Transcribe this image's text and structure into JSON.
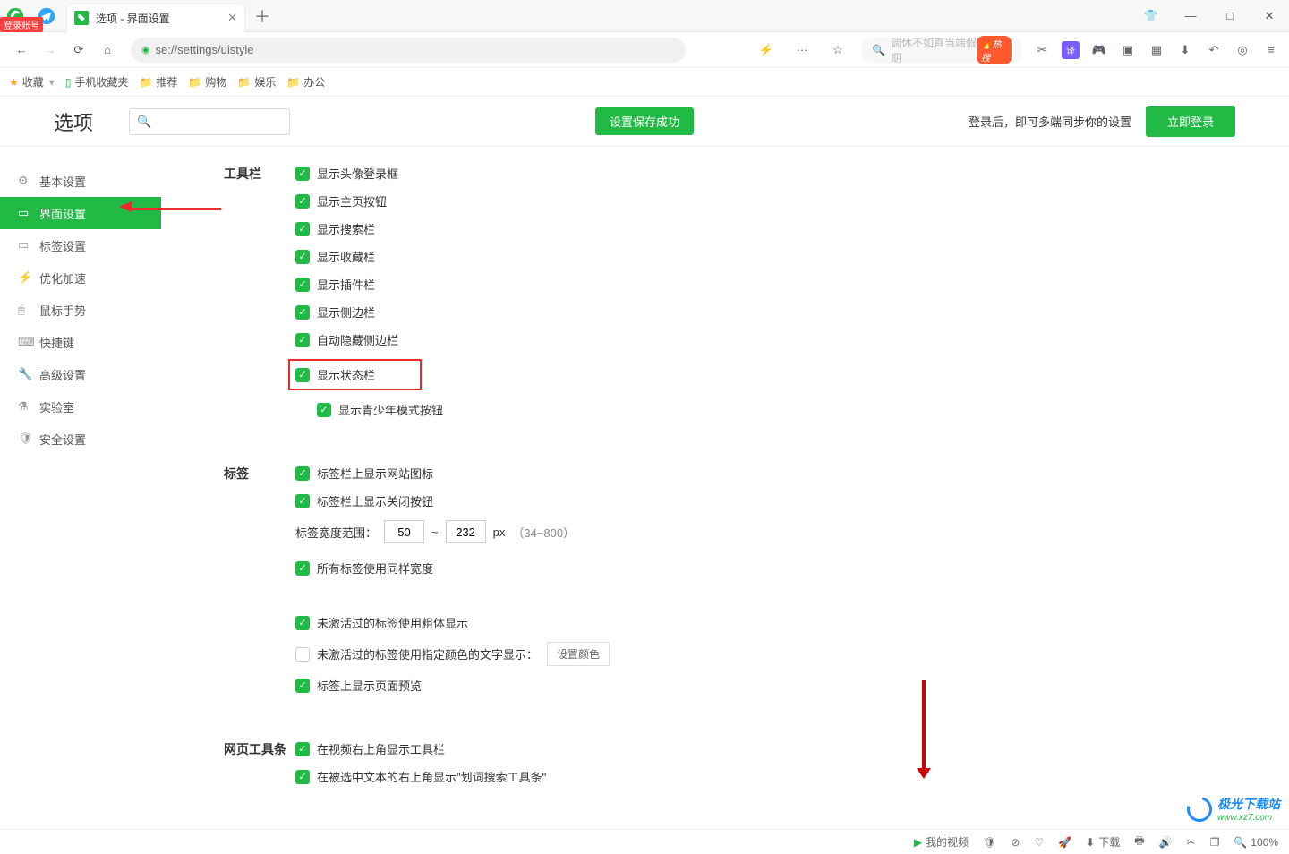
{
  "window": {
    "minimize": "—",
    "maximize": "□",
    "close": "✕",
    "tshirt": "👕"
  },
  "login_badge": "登录账号",
  "tab": {
    "title": "选项 - 界面设置"
  },
  "url": {
    "scheme_label": "●",
    "text": "se://settings/uistyle"
  },
  "addrIcons": {
    "bolt": "⚡",
    "dots": "···",
    "star": "☆"
  },
  "search_hint": {
    "placeholder": "调休不如直当端假期",
    "hot_label": "热搜"
  },
  "bookmarks": {
    "fav": "收藏",
    "phone": "手机收藏夹",
    "folders": [
      "推荐",
      "购物",
      "娱乐",
      "办公"
    ]
  },
  "header": {
    "title": "选项",
    "save_success": "设置保存成功",
    "sync_text": "登录后，即可多端同步你的设置",
    "login_btn": "立即登录"
  },
  "sidebar": [
    {
      "icon": "⚙",
      "label": "基本设置"
    },
    {
      "icon": "▭",
      "label": "界面设置"
    },
    {
      "icon": "▭",
      "label": "标签设置"
    },
    {
      "icon": "⚡",
      "label": "优化加速"
    },
    {
      "icon": "🖱",
      "label": "鼠标手势"
    },
    {
      "icon": "⌨",
      "label": "快捷键"
    },
    {
      "icon": "🔧",
      "label": "高级设置"
    },
    {
      "icon": "⚗",
      "label": "实验室"
    },
    {
      "icon": "🛡",
      "label": "安全设置"
    }
  ],
  "sections": {
    "toolbar": {
      "title": "工具栏",
      "opts": [
        "显示头像登录框",
        "显示主页按钮",
        "显示搜索栏",
        "显示收藏栏",
        "显示插件栏",
        "显示侧边栏",
        "自动隐藏侧边栏",
        "显示状态栏"
      ],
      "sub_opt": "显示青少年模式按钮"
    },
    "tabs": {
      "title": "标签",
      "opts": [
        "标签栏上显示网站图标",
        "标签栏上显示关闭按钮"
      ],
      "width": {
        "label": "标签宽度范围：",
        "min": "50",
        "sep": "~",
        "max": "232",
        "unit": "px",
        "range": "（34~800）"
      },
      "same_width": "所有标签使用同样宽度",
      "bold_inactive": "未激活过的标签使用粗体显示",
      "color_inactive": "未激活过的标签使用指定颜色的文字显示：",
      "color_btn": "设置颜色",
      "preview": "标签上显示页面预览"
    },
    "webbar": {
      "title": "网页工具条",
      "opts": [
        "在视频右上角显示工具栏",
        "在被选中文本的右上角显示\"划词搜索工具条\""
      ]
    }
  },
  "status": {
    "video": "我的视频",
    "download": "下载",
    "zoom": "100%"
  },
  "watermark": {
    "text": "极光下载站",
    "url": "www.xz7.com"
  }
}
